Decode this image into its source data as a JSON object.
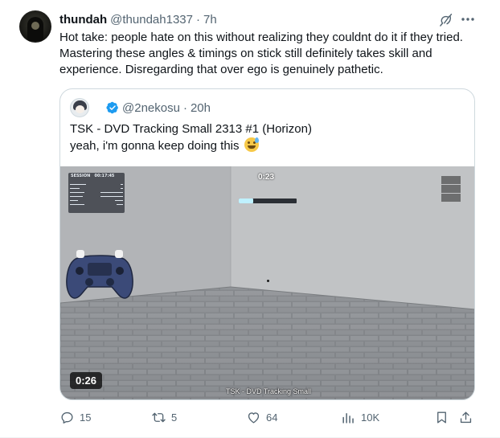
{
  "post": {
    "author_name": "thundah",
    "author_handle": "@thundah1337",
    "separator": "·",
    "time": "7h",
    "text": "Hot take: people hate on this without realizing they couldnt do it if they tried. Mastering these angles & timings on stick still definitely takes skill and experience. Disregarding that over ego is genuinely pathetic.",
    "icons": {
      "grok": "grok-icon",
      "more": "more-icon"
    }
  },
  "quote": {
    "handle": "@2nekosu",
    "separator": "·",
    "time": "20h",
    "line1": "TSK - DVD Tracking Small 2313 #1 (Horizon)",
    "line2": "yeah, i'm gonna keep doing this",
    "emoji": "sweat-smile-emoji",
    "verified_color": "#1d9bf0",
    "video": {
      "duration": "0:26",
      "hud_timer": "0:23",
      "hud_session_label": "SESSION",
      "hud_session_time": "00:17:45",
      "caption": "TSK - DVD Tracking Small",
      "progress_fraction": 0.25
    }
  },
  "actions": {
    "replies": "15",
    "reposts": "5",
    "likes": "64",
    "views": "10K"
  },
  "colors": {
    "text": "#0f1419",
    "muted": "#536471",
    "border": "#cfd9de",
    "accent": "#1d9bf0"
  }
}
